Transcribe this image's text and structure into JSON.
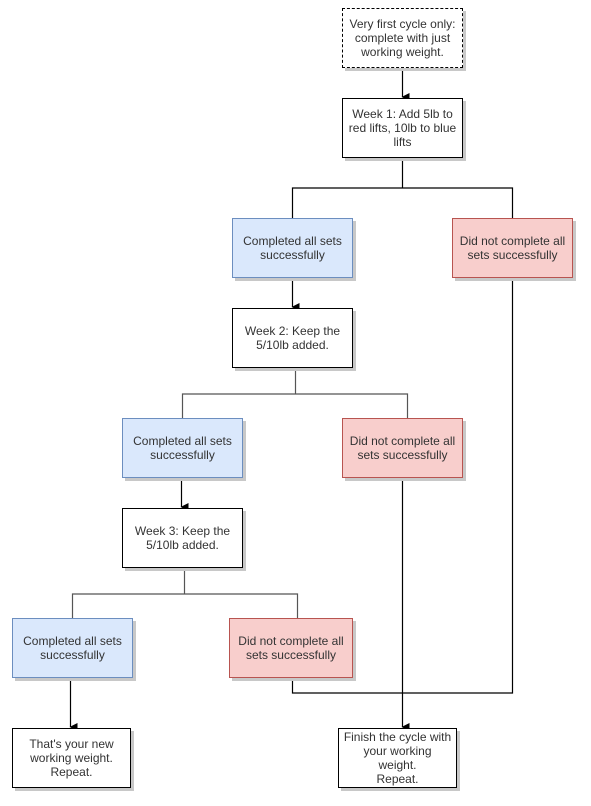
{
  "colors": {
    "success_fill": "#dae8fc",
    "success_stroke": "#6c8ebf",
    "fail_fill": "#f8cecc",
    "fail_stroke": "#b85450",
    "default_fill": "#ffffff",
    "edge": "#000000"
  },
  "nodes": {
    "start": {
      "label": "Very first cycle only:\ncomplete with just\nworking weight."
    },
    "week1": {
      "label": "Week 1: Add 5lb to\nred lifts, 10lb to blue\nlifts"
    },
    "completed1": {
      "label": "Completed all sets\nsuccessfully"
    },
    "failed1": {
      "label": "Did not complete all\nsets successfully"
    },
    "week2": {
      "label": "Week 2: Keep the\n5/10lb added."
    },
    "completed2": {
      "label": "Completed all sets\nsuccessfully"
    },
    "failed2": {
      "label": "Did not complete all\nsets successfully"
    },
    "week3": {
      "label": "Week 3: Keep the\n5/10lb added."
    },
    "completed3": {
      "label": "Completed all sets\nsuccessfully"
    },
    "failed3": {
      "label": "Did not complete all\nsets successfully"
    },
    "new_weight": {
      "label": "That's your new\nworking weight.\nRepeat."
    },
    "finish_cycle": {
      "label": "Finish the cycle with\nyour working weight.\nRepeat."
    }
  },
  "edges": [
    {
      "from": "start",
      "to": "week1"
    },
    {
      "from": "week1",
      "to": "completed1"
    },
    {
      "from": "week1",
      "to": "failed1"
    },
    {
      "from": "completed1",
      "to": "week2"
    },
    {
      "from": "week2",
      "to": "completed2"
    },
    {
      "from": "week2",
      "to": "failed2"
    },
    {
      "from": "completed2",
      "to": "week3"
    },
    {
      "from": "week3",
      "to": "completed3"
    },
    {
      "from": "week3",
      "to": "failed3"
    },
    {
      "from": "completed3",
      "to": "new_weight"
    },
    {
      "from": "failed1",
      "to": "finish_cycle"
    },
    {
      "from": "failed2",
      "to": "finish_cycle"
    },
    {
      "from": "failed3",
      "to": "finish_cycle"
    }
  ]
}
